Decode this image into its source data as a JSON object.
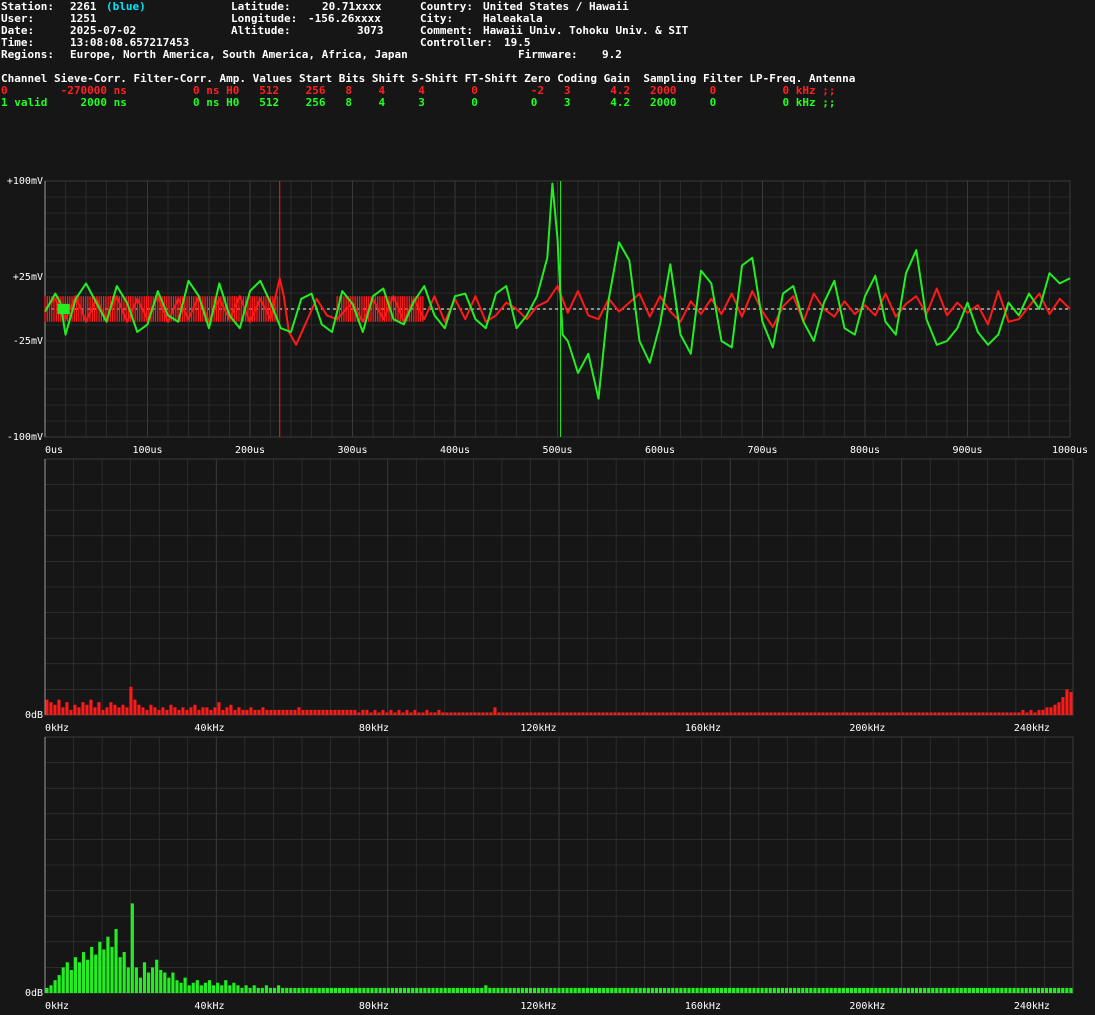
{
  "info": {
    "station_label": "Station:",
    "station_value": "2261",
    "station_color_name": "(blue)",
    "user_label": "User:",
    "user_value": "1251",
    "date_label": "Date:",
    "date_value": "2025-07-02",
    "time_label": "Time:",
    "time_value": "13:08:08.657217453",
    "regions_label": "Regions:",
    "regions_value": "Europe, North America, South America, Africa, Japan",
    "latitude_label": "Latitude:",
    "latitude_value": "20.71xxxx",
    "longitude_label": "Longitude:",
    "longitude_value": "-156.26xxxx",
    "altitude_label": "Altitude:",
    "altitude_value": "3073",
    "country_label": "Country:",
    "country_value": "United States / Hawaii",
    "city_label": "City:",
    "city_value": "Haleakala",
    "comment_label": "Comment:",
    "comment_value": "Hawaii Univ. Tohoku Univ. & SIT",
    "controller_label": "Controller:",
    "controller_value": "19.5",
    "firmware_label": "Firmware:",
    "firmware_value": "9.2"
  },
  "channel_table": {
    "header": "Channel Sieve-Corr. Filter-Corr. Amp. Values Start Bits Shift S-Shift FT-Shift Zero Coding Gain  Sampling Filter LP-Freq. Antenna",
    "rows": [
      "0        -270000 ns          0 ns H0   512    256   8    4     4       0        -2   3      4.2   2000     0          0 kHz ;;",
      "1 valid     2000 ns          0 ns H0   512    256   8    4     3       0        0    3      4.2   2000     0          0 kHz ;;"
    ]
  },
  "colors": {
    "ch0": "#ff1a1a",
    "ch1": "#22ee22",
    "cyan": "#00e5ff",
    "grid": "#3a3a3a",
    "bg": "#161616"
  },
  "chart_data": [
    {
      "type": "line",
      "xlabel": "",
      "ylabel": "",
      "x_ticks": [
        "0us",
        "100us",
        "200us",
        "300us",
        "400us",
        "500us",
        "600us",
        "700us",
        "800us",
        "900us",
        "1000us"
      ],
      "xlim": [
        0,
        1000
      ],
      "y_ticks": [
        "+100mV",
        "+25mV",
        "-25mV",
        "-100mV"
      ],
      "y_tick_values": [
        100,
        25,
        -25,
        -100
      ],
      "ylim": [
        -100,
        100
      ],
      "cursors": [
        {
          "x": 229,
          "color": "#ff1a1a"
        },
        {
          "x": 503,
          "color": "#22ee22"
        }
      ],
      "series": [
        {
          "color": "#ff1a1a",
          "x": [
            0,
            10,
            20,
            30,
            40,
            50,
            60,
            70,
            80,
            90,
            100,
            110,
            120,
            130,
            140,
            150,
            160,
            170,
            180,
            190,
            200,
            210,
            220,
            225,
            229,
            233,
            238,
            245,
            255,
            265,
            275,
            285,
            300,
            310,
            320,
            330,
            340,
            350,
            360,
            370,
            380,
            390,
            400,
            410,
            420,
            430,
            440,
            450,
            460,
            470,
            480,
            490,
            500,
            510,
            520,
            530,
            540,
            550,
            560,
            570,
            580,
            590,
            600,
            610,
            620,
            630,
            640,
            650,
            660,
            670,
            680,
            690,
            700,
            710,
            720,
            730,
            740,
            750,
            760,
            770,
            780,
            790,
            800,
            810,
            820,
            830,
            840,
            850,
            860,
            870,
            880,
            890,
            900,
            910,
            920,
            930,
            940,
            950,
            960,
            970,
            980,
            990,
            1000
          ],
          "y": [
            0,
            8,
            -8,
            10,
            -10,
            8,
            -8,
            10,
            -10,
            8,
            -8,
            10,
            -10,
            8,
            -8,
            10,
            -10,
            8,
            -8,
            10,
            -10,
            8,
            -8,
            10,
            24,
            10,
            -18,
            -28,
            -10,
            8,
            -5,
            -8,
            5,
            -10,
            8,
            -8,
            10,
            -10,
            8,
            -8,
            10,
            -10,
            8,
            -8,
            10,
            -10,
            -5,
            5,
            0,
            -8,
            2,
            6,
            18,
            -3,
            14,
            -5,
            -8,
            8,
            -2,
            5,
            12,
            -6,
            10,
            -2,
            -10,
            6,
            -4,
            8,
            -4,
            12,
            -6,
            14,
            -2,
            -14,
            2,
            10,
            -10,
            12,
            0,
            -6,
            6,
            -4,
            3,
            -5,
            12,
            -6,
            4,
            10,
            -4,
            16,
            -5,
            5,
            -3,
            3,
            -12,
            14,
            -10,
            -8,
            2,
            12,
            -4,
            8,
            0
          ]
        },
        {
          "color": "#22ee22",
          "x": [
            0,
            10,
            15,
            20,
            30,
            40,
            50,
            60,
            70,
            80,
            90,
            100,
            110,
            120,
            130,
            140,
            150,
            160,
            170,
            180,
            190,
            200,
            210,
            220,
            230,
            240,
            250,
            260,
            270,
            280,
            290,
            300,
            310,
            320,
            330,
            340,
            350,
            360,
            370,
            380,
            390,
            400,
            410,
            420,
            430,
            440,
            450,
            460,
            470,
            480,
            490,
            495,
            500,
            505,
            510,
            520,
            530,
            540,
            550,
            560,
            570,
            580,
            590,
            600,
            610,
            620,
            630,
            640,
            650,
            660,
            670,
            680,
            690,
            700,
            710,
            720,
            730,
            740,
            750,
            760,
            770,
            780,
            790,
            800,
            810,
            820,
            830,
            840,
            850,
            860,
            870,
            880,
            890,
            900,
            910,
            920,
            930,
            940,
            950,
            960,
            970,
            980,
            990,
            1000
          ],
          "y": [
            -2,
            12,
            5,
            -20,
            8,
            20,
            5,
            -10,
            18,
            5,
            -18,
            -12,
            14,
            -5,
            -10,
            22,
            10,
            -15,
            20,
            -5,
            -15,
            14,
            22,
            5,
            -15,
            -18,
            8,
            12,
            -12,
            -18,
            14,
            4,
            -18,
            10,
            16,
            -8,
            -12,
            6,
            18,
            -5,
            -15,
            10,
            12,
            -8,
            -15,
            12,
            18,
            -15,
            -5,
            10,
            40,
            98,
            55,
            -20,
            -25,
            -50,
            -35,
            -70,
            8,
            52,
            38,
            -25,
            -42,
            -12,
            35,
            -20,
            -35,
            30,
            20,
            -25,
            -30,
            34,
            40,
            -10,
            -30,
            12,
            18,
            -10,
            -25,
            5,
            22,
            -15,
            -20,
            10,
            26,
            -10,
            -20,
            28,
            46,
            -8,
            -28,
            -25,
            -15,
            5,
            -18,
            -28,
            -20,
            5,
            -5,
            12,
            0,
            28,
            20,
            24
          ]
        }
      ]
    },
    {
      "type": "bar",
      "xlabel": "",
      "ylabel": "",
      "x_ticks": [
        "0kHz",
        "40kHz",
        "80kHz",
        "120kHz",
        "160kHz",
        "200kHz",
        "240kHz"
      ],
      "y_ticks": [
        "0dB"
      ],
      "xlim": [
        0,
        250
      ],
      "ylim": [
        0,
        1
      ],
      "bin_width_khz": 1,
      "series": [
        {
          "color": "#ff1a1a",
          "values": [
            0.06,
            0.05,
            0.04,
            0.06,
            0.03,
            0.05,
            0.02,
            0.04,
            0.03,
            0.05,
            0.04,
            0.06,
            0.03,
            0.05,
            0.02,
            0.03,
            0.05,
            0.04,
            0.03,
            0.04,
            0.03,
            0.11,
            0.06,
            0.04,
            0.03,
            0.02,
            0.04,
            0.03,
            0.02,
            0.03,
            0.02,
            0.04,
            0.03,
            0.02,
            0.03,
            0.02,
            0.03,
            0.04,
            0.02,
            0.03,
            0.03,
            0.02,
            0.03,
            0.05,
            0.02,
            0.03,
            0.04,
            0.02,
            0.03,
            0.02,
            0.02,
            0.03,
            0.02,
            0.02,
            0.03,
            0.02,
            0.02,
            0.02,
            0.02,
            0.02,
            0.02,
            0.02,
            0.02,
            0.03,
            0.02,
            0.02,
            0.02,
            0.02,
            0.02,
            0.02,
            0.02,
            0.02,
            0.02,
            0.02,
            0.02,
            0.02,
            0.02,
            0.02,
            0.01,
            0.02,
            0.02,
            0.01,
            0.02,
            0.01,
            0.02,
            0.01,
            0.02,
            0.01,
            0.02,
            0.01,
            0.02,
            0.01,
            0.02,
            0.01,
            0.01,
            0.02,
            0.01,
            0.01,
            0.02,
            0.01,
            0.01,
            0.01,
            0.01,
            0.01,
            0.01,
            0.01,
            0.01,
            0.01,
            0.01,
            0.01,
            0.01,
            0.01,
            0.03,
            0.01,
            0.01,
            0.01,
            0.01,
            0.01,
            0.01,
            0.01,
            0.01,
            0.01,
            0.01,
            0.01,
            0.01,
            0.01,
            0.01,
            0.01,
            0.01,
            0.01,
            0.01,
            0.01,
            0.01,
            0.01,
            0.01,
            0.01,
            0.01,
            0.01,
            0.01,
            0.01,
            0.01,
            0.01,
            0.01,
            0.01,
            0.01,
            0.01,
            0.01,
            0.01,
            0.01,
            0.01,
            0.01,
            0.01,
            0.01,
            0.01,
            0.01,
            0.01,
            0.01,
            0.01,
            0.01,
            0.01,
            0.01,
            0.01,
            0.01,
            0.01,
            0.01,
            0.01,
            0.01,
            0.01,
            0.01,
            0.01,
            0.01,
            0.01,
            0.01,
            0.01,
            0.01,
            0.01,
            0.01,
            0.01,
            0.01,
            0.01,
            0.01,
            0.01,
            0.01,
            0.01,
            0.01,
            0.01,
            0.01,
            0.01,
            0.01,
            0.01,
            0.01,
            0.01,
            0.01,
            0.01,
            0.01,
            0.01,
            0.01,
            0.01,
            0.01,
            0.01,
            0.01,
            0.01,
            0.01,
            0.01,
            0.01,
            0.01,
            0.01,
            0.01,
            0.01,
            0.01,
            0.01,
            0.01,
            0.01,
            0.01,
            0.01,
            0.01,
            0.01,
            0.01,
            0.01,
            0.01,
            0.01,
            0.01,
            0.01,
            0.01,
            0.01,
            0.01,
            0.01,
            0.01,
            0.01,
            0.01,
            0.01,
            0.01,
            0.01,
            0.01,
            0.01,
            0.01,
            0.01,
            0.01,
            0.01,
            0.01,
            0.01,
            0.01,
            0.01,
            0.01,
            0.02,
            0.01,
            0.02,
            0.01,
            0.02,
            0.02,
            0.03,
            0.03,
            0.04,
            0.05,
            0.07,
            0.1,
            0.09
          ]
        }
      ]
    },
    {
      "type": "bar",
      "xlabel": "",
      "ylabel": "",
      "x_ticks": [
        "0kHz",
        "40kHz",
        "80kHz",
        "120kHz",
        "160kHz",
        "200kHz",
        "240kHz"
      ],
      "y_ticks": [
        "0dB"
      ],
      "xlim": [
        0,
        250
      ],
      "ylim": [
        0,
        1
      ],
      "bin_width_khz": 1,
      "series": [
        {
          "color": "#22ee22",
          "values": [
            0.02,
            0.03,
            0.05,
            0.07,
            0.1,
            0.12,
            0.09,
            0.14,
            0.12,
            0.16,
            0.13,
            0.18,
            0.15,
            0.2,
            0.17,
            0.22,
            0.18,
            0.25,
            0.14,
            0.16,
            0.1,
            0.35,
            0.1,
            0.06,
            0.12,
            0.08,
            0.1,
            0.13,
            0.09,
            0.08,
            0.06,
            0.08,
            0.05,
            0.04,
            0.06,
            0.03,
            0.04,
            0.05,
            0.03,
            0.04,
            0.05,
            0.03,
            0.04,
            0.03,
            0.05,
            0.03,
            0.04,
            0.03,
            0.02,
            0.03,
            0.02,
            0.03,
            0.02,
            0.02,
            0.03,
            0.02,
            0.02,
            0.03,
            0.02,
            0.02,
            0.02,
            0.02,
            0.02,
            0.02,
            0.02,
            0.02,
            0.02,
            0.02,
            0.02,
            0.02,
            0.02,
            0.02,
            0.02,
            0.02,
            0.02,
            0.02,
            0.02,
            0.02,
            0.02,
            0.02,
            0.02,
            0.02,
            0.02,
            0.02,
            0.02,
            0.02,
            0.02,
            0.02,
            0.02,
            0.02,
            0.02,
            0.02,
            0.02,
            0.02,
            0.02,
            0.02,
            0.02,
            0.02,
            0.02,
            0.02,
            0.02,
            0.02,
            0.02,
            0.02,
            0.02,
            0.02,
            0.02,
            0.02,
            0.03,
            0.02,
            0.02,
            0.02,
            0.02,
            0.02,
            0.02,
            0.02,
            0.02,
            0.02,
            0.02,
            0.02,
            0.02,
            0.02,
            0.02,
            0.02,
            0.02,
            0.02,
            0.02,
            0.02,
            0.02,
            0.02,
            0.02,
            0.02,
            0.02,
            0.02,
            0.02,
            0.02,
            0.02,
            0.02,
            0.02,
            0.02,
            0.02,
            0.02,
            0.02,
            0.02,
            0.02,
            0.02,
            0.02,
            0.02,
            0.02,
            0.02,
            0.02,
            0.02,
            0.02,
            0.02,
            0.02,
            0.02,
            0.02,
            0.02,
            0.02,
            0.02,
            0.02,
            0.02,
            0.02,
            0.02,
            0.02,
            0.02,
            0.02,
            0.02,
            0.02,
            0.02,
            0.02,
            0.02,
            0.02,
            0.02,
            0.02,
            0.02,
            0.02,
            0.02,
            0.02,
            0.02,
            0.02,
            0.02,
            0.02,
            0.02,
            0.02,
            0.02,
            0.02,
            0.02,
            0.02,
            0.02,
            0.02,
            0.02,
            0.02,
            0.02,
            0.02,
            0.02,
            0.02,
            0.02,
            0.02,
            0.02,
            0.02,
            0.02,
            0.02,
            0.02,
            0.02,
            0.02,
            0.02,
            0.02,
            0.02,
            0.02,
            0.02,
            0.02,
            0.02,
            0.02,
            0.02,
            0.02,
            0.02,
            0.02,
            0.02,
            0.02,
            0.02,
            0.02,
            0.02,
            0.02,
            0.02,
            0.02,
            0.02,
            0.02,
            0.02,
            0.02,
            0.02,
            0.02,
            0.02,
            0.02,
            0.02,
            0.02,
            0.02,
            0.02,
            0.02,
            0.02,
            0.02,
            0.02,
            0.02,
            0.02,
            0.02,
            0.02,
            0.02,
            0.02,
            0.02,
            0.02,
            0.02,
            0.02,
            0.02
          ]
        }
      ]
    }
  ]
}
